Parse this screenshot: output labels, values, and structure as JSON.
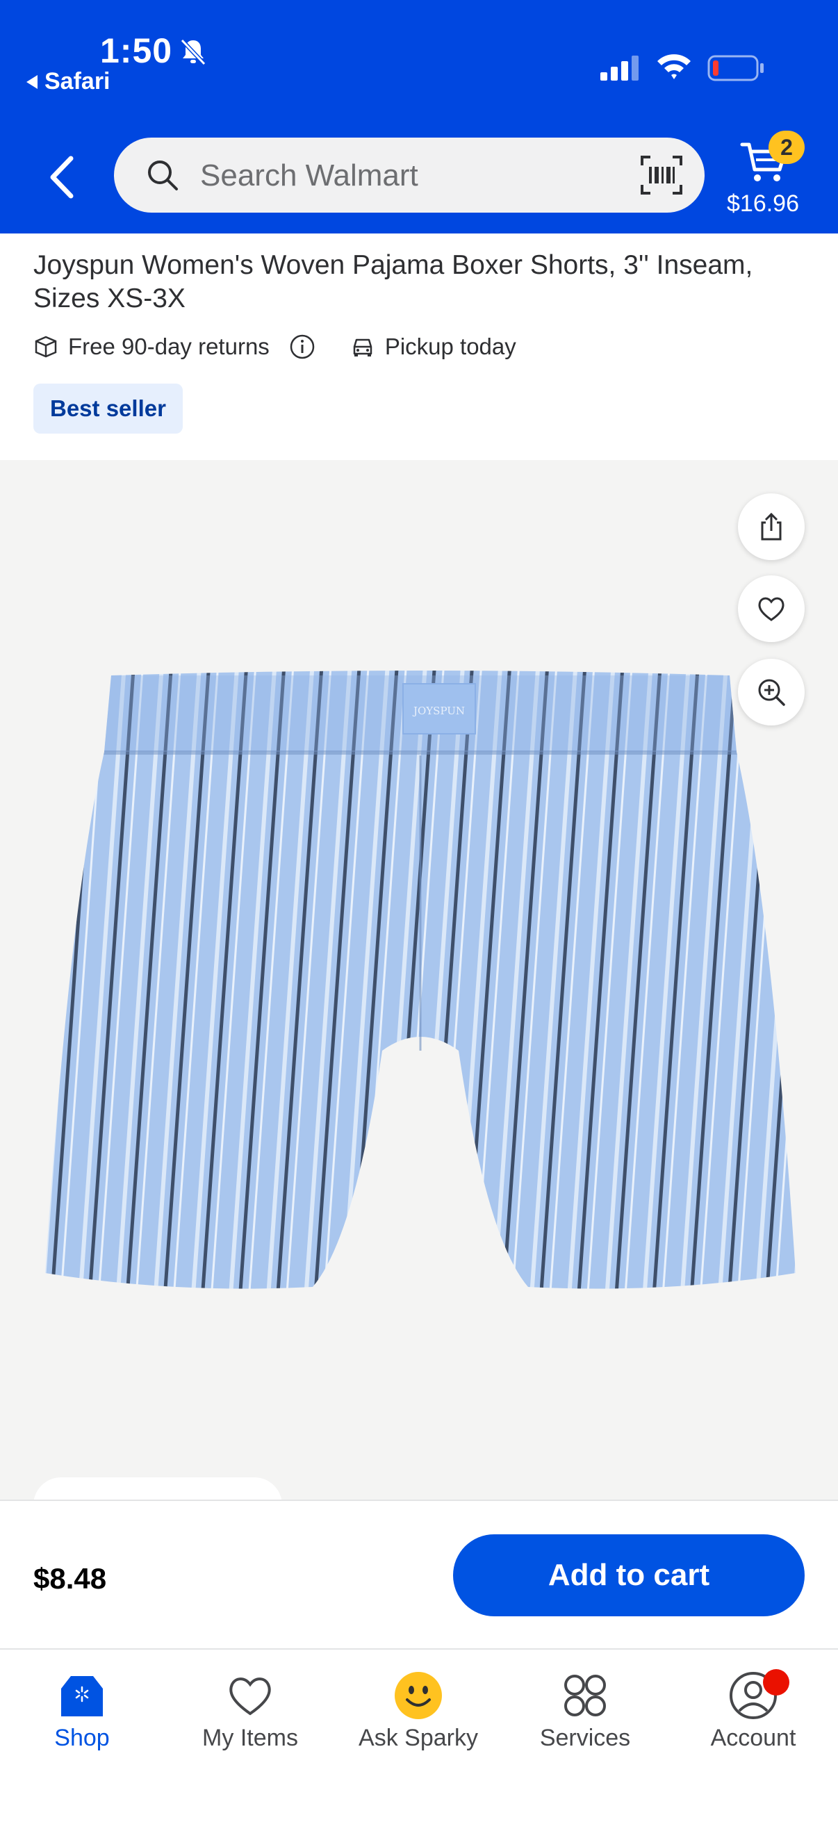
{
  "status_bar": {
    "time": "1:50",
    "back_app": "Safari"
  },
  "header": {
    "search_placeholder": "Search Walmart",
    "cart_count": "2",
    "cart_total": "$16.96"
  },
  "product": {
    "title": "Joyspun Women's Woven Pajama Boxer Shorts, 3'' Inseam, Sizes XS-3X",
    "returns": "Free 90-day returns",
    "pickup": "Pickup today",
    "badge": "Best seller",
    "brand_tag": "JOYSPUN"
  },
  "buy_bar": {
    "price": "$8.48",
    "add_to_cart": "Add to cart"
  },
  "tabs": [
    {
      "label": "Shop",
      "icon": "shop-icon"
    },
    {
      "label": "My Items",
      "icon": "heart-icon"
    },
    {
      "label": "Ask Sparky",
      "icon": "sparky-icon"
    },
    {
      "label": "Services",
      "icon": "services-icon"
    },
    {
      "label": "Account",
      "icon": "account-icon"
    }
  ],
  "colors": {
    "brand_blue": "#0047e0",
    "button_blue": "#0053e2",
    "spark_yellow": "#ffc220",
    "alert_red": "#ea1100"
  }
}
